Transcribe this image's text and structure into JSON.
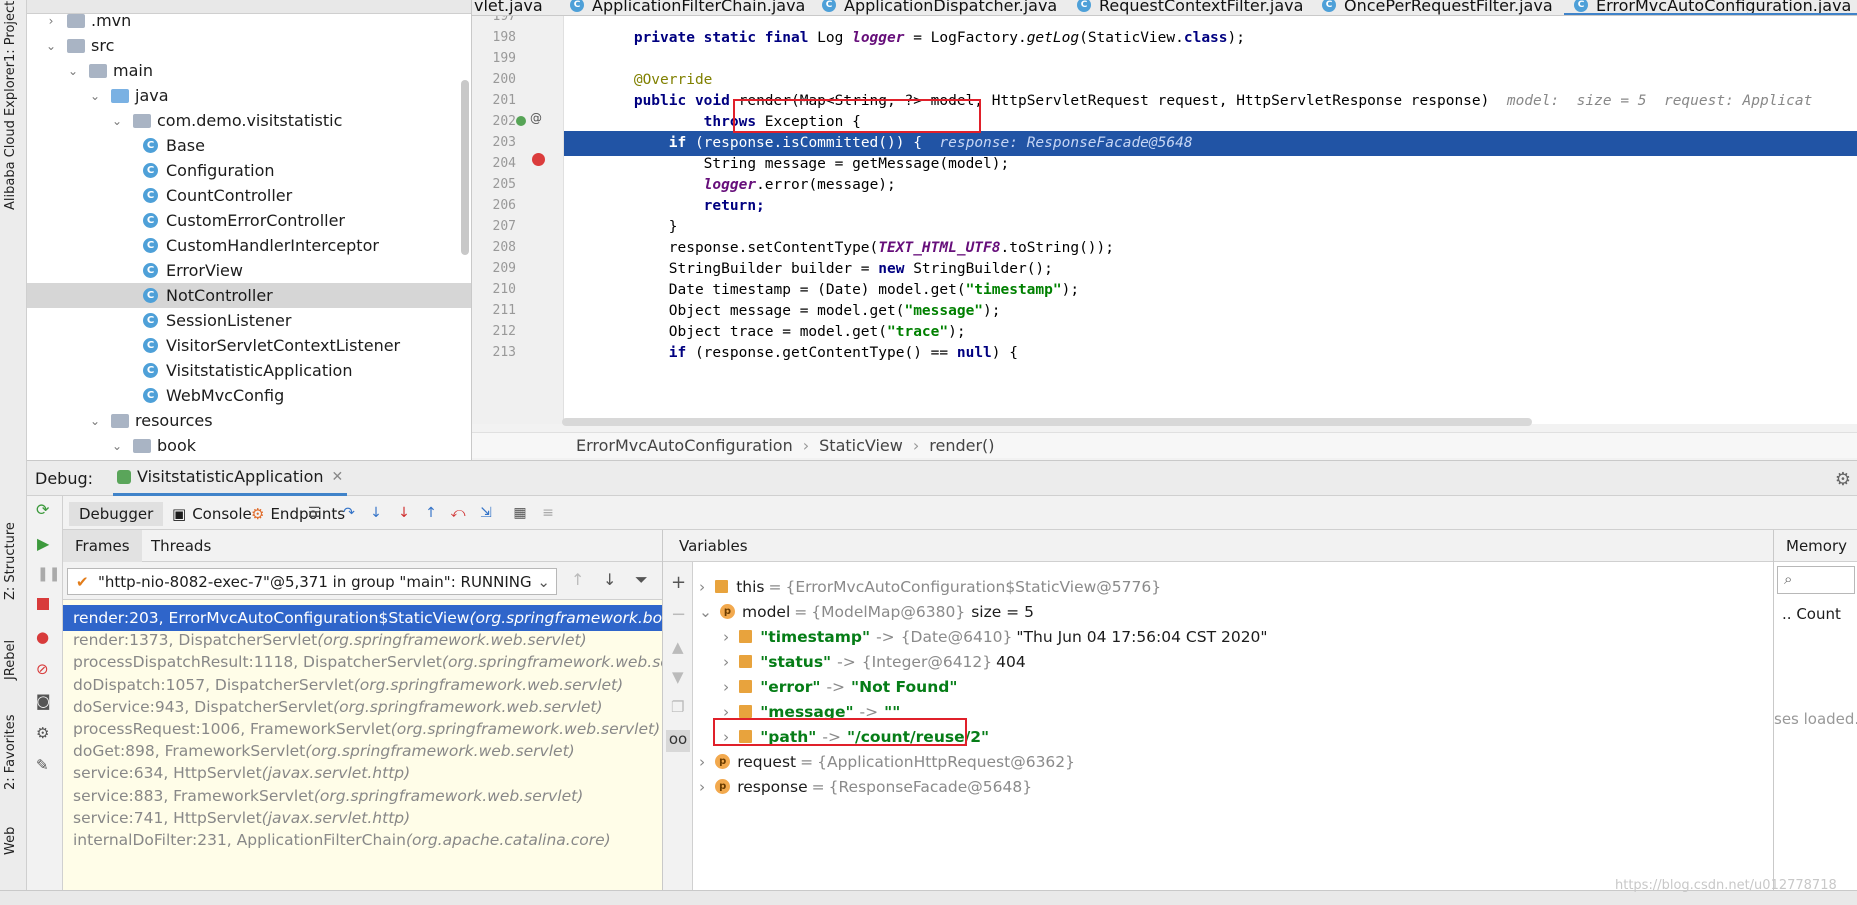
{
  "left_strip": {
    "project_label": "1: Project",
    "cloud_label": "Alibaba Cloud Explorer",
    "structure_label": "Z: Structure",
    "jrebel_label": "JRebel",
    "favorites_label": "2: Favorites",
    "web_label": "Web"
  },
  "project": {
    "title": "Project",
    "tree": [
      {
        "label": ".mvn",
        "type": "folder",
        "indent": 0,
        "expanded": false
      },
      {
        "label": "src",
        "type": "folder",
        "indent": 0,
        "expanded": true
      },
      {
        "label": "main",
        "type": "folder",
        "indent": 1,
        "expanded": true
      },
      {
        "label": "java",
        "type": "folder-blue",
        "indent": 2,
        "expanded": true
      },
      {
        "label": "com.demo.visitstatistic",
        "type": "package",
        "indent": 3,
        "expanded": true
      },
      {
        "label": "Base",
        "type": "class",
        "indent": 4
      },
      {
        "label": "Configuration",
        "type": "class",
        "indent": 4
      },
      {
        "label": "CountController",
        "type": "class",
        "indent": 4
      },
      {
        "label": "CustomErrorController",
        "type": "class",
        "indent": 4
      },
      {
        "label": "CustomHandlerInterceptor",
        "type": "class",
        "indent": 4
      },
      {
        "label": "ErrorView",
        "type": "class",
        "indent": 4
      },
      {
        "label": "NotController",
        "type": "class",
        "indent": 4,
        "selected": true
      },
      {
        "label": "SessionListener",
        "type": "class",
        "indent": 4
      },
      {
        "label": "VisitorServletContextListener",
        "type": "class",
        "indent": 4
      },
      {
        "label": "VisitstatisticApplication",
        "type": "class",
        "indent": 4
      },
      {
        "label": "WebMvcConfig",
        "type": "class",
        "indent": 4
      },
      {
        "label": "resources",
        "type": "folder",
        "indent": 2,
        "expanded": true
      },
      {
        "label": "book",
        "type": "folder",
        "indent": 3,
        "expanded": true
      }
    ]
  },
  "tabs": [
    "vlet.java",
    "ApplicationFilterChain.java",
    "ApplicationDispatcher.java",
    "RequestContextFilter.java",
    "OncePerRequestFilter.java",
    "ErrorMvcAutoConfiguration.java"
  ],
  "editor": {
    "line_numbers": [
      "197",
      "198",
      "199",
      "200",
      "201",
      "202",
      "203",
      "204",
      "205",
      "206",
      "207",
      "208",
      "209",
      "210",
      "211",
      "212",
      "213"
    ],
    "lines": {
      "l198_a": "        private static final ",
      "l198_b": "Log ",
      "l198_c": "logger",
      "l198_d": " = LogFactory.",
      "l198_e": "getLog",
      "l198_f": "(StaticView.",
      "l198_g": "class",
      "l198_h": ");",
      "l200": "        @Override",
      "l201_a": "        public void ",
      "l201_b": "render(Map<String, ?> model, HttpServletRequest request, HttpServletResponse response)",
      "l201_hint": "  model:  size = 5  request: Applicat",
      "l202_a": "                throws ",
      "l202_b": "Exception {",
      "l203_a": "            if ",
      "l203_b": "(response.isCommitted()) {",
      "l203_hint": "  response: ResponseFacade@5648",
      "l204": "                String message = getMessage(model);",
      "l205_a": "                ",
      "l205_b": "logger",
      "l205_c": ".error(message);",
      "l206": "                return;",
      "l207": "            }",
      "l208_a": "            response.setContentType(",
      "l208_b": "TEXT_HTML_UTF8",
      "l208_c": ".toString());",
      "l209_a": "            StringBuilder builder = ",
      "l209_b": "new ",
      "l209_c": "StringBuilder();",
      "l210_a": "            Date timestamp = (Date) model.get(",
      "l210_b": "\"timestamp\"",
      "l210_c": ");",
      "l211_a": "            Object message = model.get(",
      "l211_b": "\"message\"",
      "l211_c": ");",
      "l212_a": "            Object trace = model.get(",
      "l212_b": "\"trace\"",
      "l212_c": ");",
      "l213_a": "            if ",
      "l213_b": "(response.getContentType() == ",
      "l213_c": "null",
      "l213_d": ") {"
    },
    "breadcrumb": [
      "ErrorMvcAutoConfiguration",
      "StaticView",
      "render()"
    ]
  },
  "debug": {
    "label": "Debug:",
    "config": "VisitstatisticApplication",
    "tabs": [
      "Debugger",
      "Console",
      "Endpoints"
    ],
    "frames_tab": "Frames",
    "threads_tab": "Threads",
    "thread": "\"http-nio-8082-exec-7\"@5,371 in group \"main\": RUNNING",
    "frames": [
      {
        "method": "render:203, ErrorMvcAutoConfiguration$StaticView ",
        "pkg": "(org.springframework.boot.a",
        "selected": true
      },
      {
        "method": "render:1373, DispatcherServlet ",
        "pkg": "(org.springframework.web.servlet)"
      },
      {
        "method": "processDispatchResult:1118, DispatcherServlet ",
        "pkg": "(org.springframework.web.servle"
      },
      {
        "method": "doDispatch:1057, DispatcherServlet ",
        "pkg": "(org.springframework.web.servlet)"
      },
      {
        "method": "doService:943, DispatcherServlet ",
        "pkg": "(org.springframework.web.servlet)"
      },
      {
        "method": "processRequest:1006, FrameworkServlet ",
        "pkg": "(org.springframework.web.servlet)"
      },
      {
        "method": "doGet:898, FrameworkServlet ",
        "pkg": "(org.springframework.web.servlet)"
      },
      {
        "method": "service:634, HttpServlet ",
        "pkg": "(javax.servlet.http)"
      },
      {
        "method": "service:883, FrameworkServlet ",
        "pkg": "(org.springframework.web.servlet)"
      },
      {
        "method": "service:741, HttpServlet ",
        "pkg": "(javax.servlet.http)"
      },
      {
        "method": "internalDoFilter:231, ApplicationFilterChain ",
        "pkg": "(org.apache.catalina.core)"
      }
    ],
    "variables_title": "Variables",
    "memory_title": "Memory",
    "memory_count": "Count",
    "memory_status": "ses loaded.",
    "vars": {
      "this_name": "this",
      "this_val": "{ErrorMvcAutoConfiguration$StaticView@5776}",
      "model_name": "model",
      "model_val": "{ModelMap@6380}",
      "model_size": "size = 5",
      "ts_key": "\"timestamp\"",
      "ts_type": "{Date@6410}",
      "ts_val": "\"Thu Jun 04 17:56:04 CST 2020\"",
      "status_key": "\"status\"",
      "status_type": "{Integer@6412}",
      "status_val": "404",
      "error_key": "\"error\"",
      "error_val": "\"Not Found\"",
      "message_key": "\"message\"",
      "message_val": "\"\"",
      "path_key": "\"path\"",
      "path_val": "\"/count/reuse/2\"",
      "request_name": "request",
      "request_val": "{ApplicationHttpRequest@6362}",
      "response_name": "response",
      "response_val": "{ResponseFacade@5648}",
      "arrow": "->",
      "eq": "="
    }
  },
  "watermark": "https://blog.csdn.net/u012778718"
}
